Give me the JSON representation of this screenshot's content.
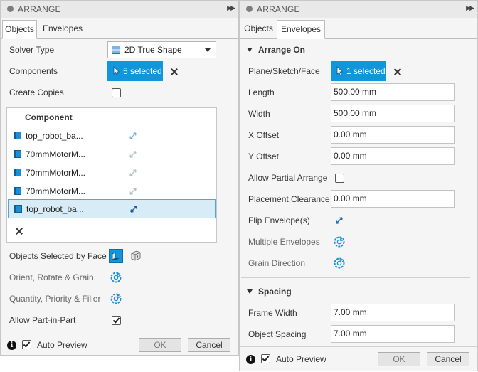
{
  "left": {
    "title": "ARRANGE",
    "tabs": [
      {
        "label": "Objects"
      },
      {
        "label": "Envelopes"
      }
    ],
    "solver_type": {
      "label": "Solver Type",
      "value": "2D True Shape"
    },
    "components": {
      "label": "Components",
      "selection": "5 selected"
    },
    "create_copies": {
      "label": "Create Copies",
      "checked": false
    },
    "component_table": {
      "header": "Component",
      "rows": [
        {
          "name": "top_robot_ba..."
        },
        {
          "name": "70mmMotorM..."
        },
        {
          "name": "70mmMotorM..."
        },
        {
          "name": "70mmMotorM..."
        },
        {
          "name": "top_robot_ba..."
        }
      ],
      "selected_row": 4
    },
    "objects_selected_by_face": {
      "label": "Objects Selected by Face"
    },
    "orient": {
      "label": "Orient, Rotate & Grain"
    },
    "quantity": {
      "label": "Quantity, Priority & Filler"
    },
    "part_in_part": {
      "label": "Allow Part-in-Part",
      "checked": true
    },
    "footer": {
      "auto_preview": "Auto Preview",
      "ok": "OK",
      "cancel": "Cancel"
    }
  },
  "right": {
    "title": "ARRANGE",
    "tabs": [
      {
        "label": "Objects"
      },
      {
        "label": "Envelopes"
      }
    ],
    "arrange_on": {
      "section": "Arrange On",
      "plane": {
        "label": "Plane/Sketch/Face",
        "selection": "1 selected"
      },
      "length": {
        "label": "Length",
        "value": "500.00 mm"
      },
      "width": {
        "label": "Width",
        "value": "500.00 mm"
      },
      "x_offset": {
        "label": "X Offset",
        "value": "0.00 mm"
      },
      "y_offset": {
        "label": "Y Offset",
        "value": "0.00 mm"
      },
      "partial": {
        "label": "Allow Partial Arrange",
        "checked": false
      },
      "clearance": {
        "label": "Placement Clearance",
        "value": "0.00 mm"
      },
      "flip": {
        "label": "Flip Envelope(s)"
      },
      "multiple": {
        "label": "Multiple Envelopes"
      },
      "grain": {
        "label": "Grain Direction"
      }
    },
    "spacing": {
      "section": "Spacing",
      "frame_width": {
        "label": "Frame Width",
        "value": "7.00 mm"
      },
      "object_spacing": {
        "label": "Object Spacing",
        "value": "7.00 mm"
      }
    },
    "footer": {
      "auto_preview": "Auto Preview",
      "ok": "OK",
      "cancel": "Cancel"
    }
  },
  "colors": {
    "accent": "#1296db",
    "selected_row": "#d8ecf8"
  }
}
